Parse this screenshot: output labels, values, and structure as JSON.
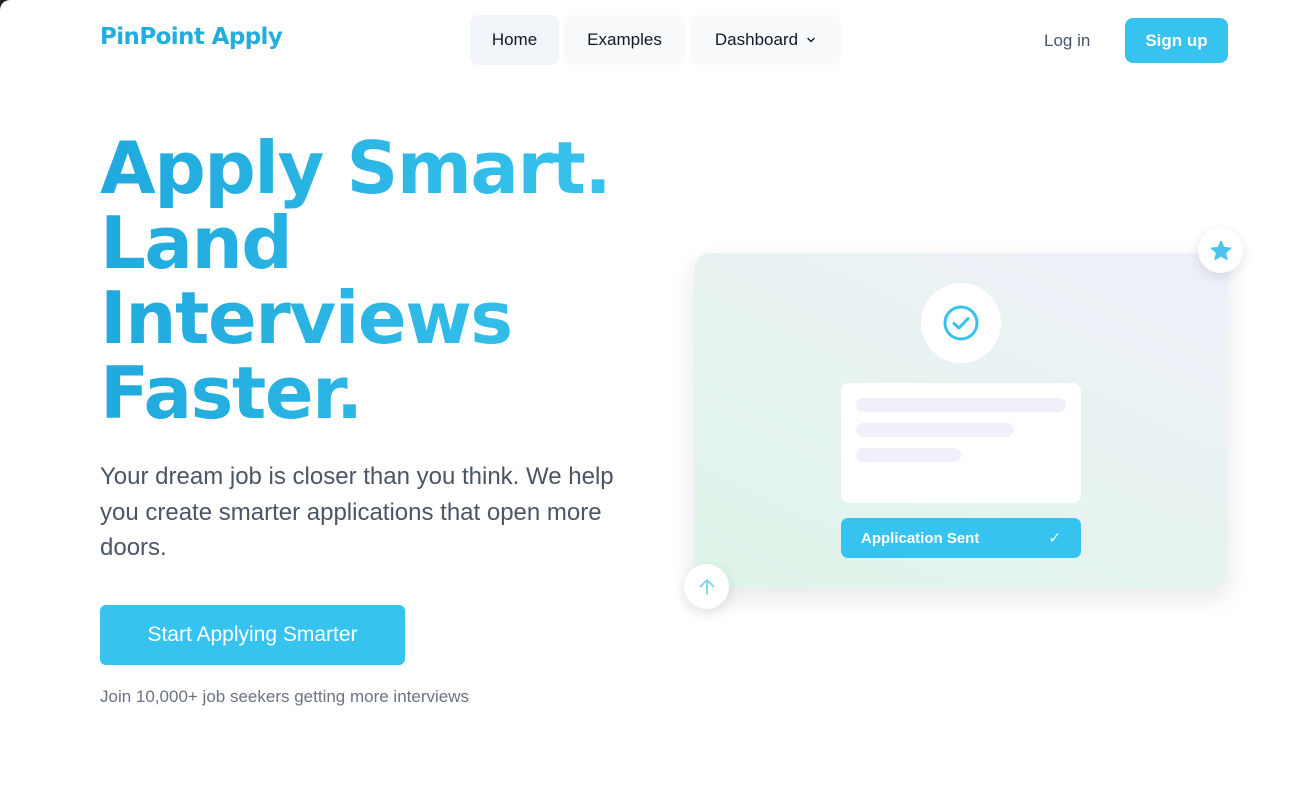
{
  "header": {
    "logo": "PinPoint Apply",
    "nav": [
      {
        "label": "Home"
      },
      {
        "label": "Examples"
      },
      {
        "label": "Dashboard"
      }
    ],
    "login_label": "Log in",
    "signup_label": "Sign up"
  },
  "hero": {
    "headline": [
      "Apply Smart.",
      "Land",
      "Interviews",
      "Faster."
    ],
    "subtitle": "Your dream job is closer than you think. We help you create smarter applications that open more doors.",
    "cta_label": "Start Applying Smarter",
    "social_proof": "Join 10,000+ job seekers getting more interviews"
  },
  "illustration": {
    "status_label": "Application Sent",
    "status_mark": "✓",
    "icons": [
      "check-circle-icon",
      "star-icon",
      "arrow-up-icon"
    ]
  },
  "colors": {
    "brand": "#22ade0",
    "accent": "#36c3ef",
    "text": "#111827",
    "muted": "#6b7280"
  }
}
